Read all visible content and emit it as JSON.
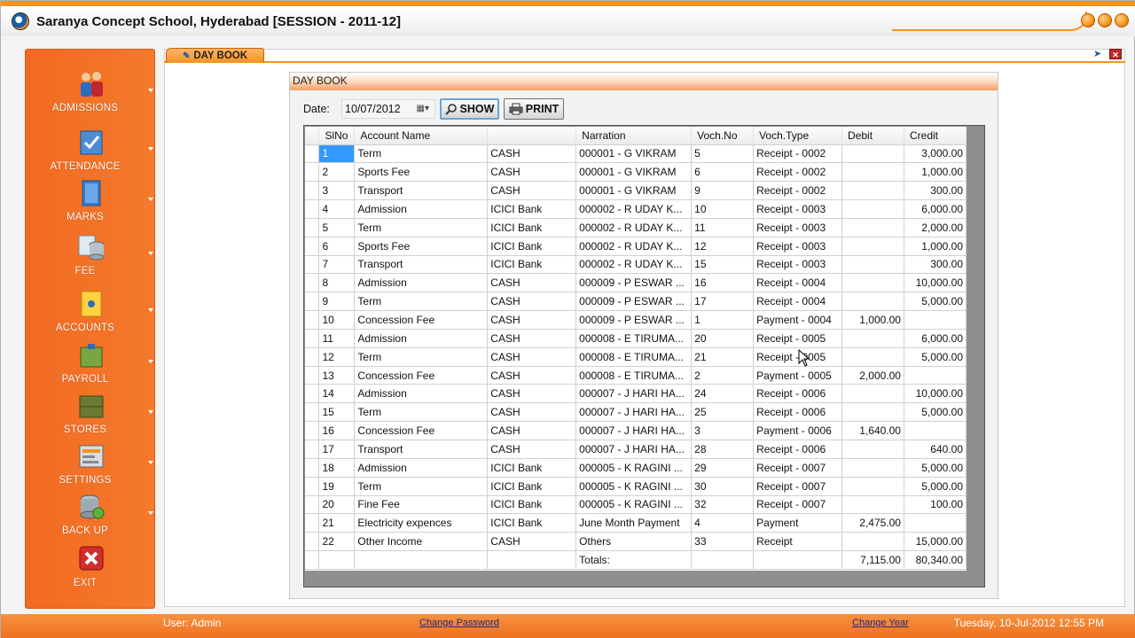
{
  "window": {
    "title": "Saranya Concept School, Hyderabad [SESSION - 2011-12]"
  },
  "sidebar": {
    "items": [
      {
        "label": "ADMISSIONS",
        "icon": "admissions-icon"
      },
      {
        "label": "ATTENDANCE",
        "icon": "attendance-icon"
      },
      {
        "label": "MARKS",
        "icon": "marks-icon"
      },
      {
        "label": "FEE",
        "icon": "fee-icon"
      },
      {
        "label": "ACCOUNTS",
        "icon": "accounts-icon"
      },
      {
        "label": "PAYROLL",
        "icon": "payroll-icon"
      },
      {
        "label": "STORES",
        "icon": "stores-icon"
      },
      {
        "label": "SETTINGS",
        "icon": "settings-icon"
      },
      {
        "label": "BACK UP",
        "icon": "backup-icon"
      },
      {
        "label": "EXIT",
        "icon": "exit-icon"
      }
    ]
  },
  "tab": {
    "label": "DAY BOOK"
  },
  "panel": {
    "header": "DAY BOOK",
    "date_label": "Date:",
    "date_value": "10/07/2012",
    "show_label": "SHOW",
    "print_label": "PRINT"
  },
  "grid": {
    "columns": [
      "SlNo",
      "Account Name",
      "",
      "Narration",
      "Voch.No",
      "Voch.Type",
      "Debit",
      "Credit"
    ],
    "rows": [
      [
        "1",
        "Term",
        "CASH",
        "000001 - G VIKRAM",
        "5",
        "Receipt - 0002",
        "",
        "3,000.00"
      ],
      [
        "2",
        "Sports Fee",
        "CASH",
        "000001 - G VIKRAM",
        "6",
        "Receipt - 0002",
        "",
        "1,000.00"
      ],
      [
        "3",
        "Transport",
        "CASH",
        "000001 - G VIKRAM",
        "9",
        "Receipt - 0002",
        "",
        "300.00"
      ],
      [
        "4",
        "Admission",
        "ICICI Bank",
        "000002 - R UDAY K...",
        "10",
        "Receipt - 0003",
        "",
        "6,000.00"
      ],
      [
        "5",
        "Term",
        "ICICI Bank",
        "000002 - R UDAY K...",
        "11",
        "Receipt - 0003",
        "",
        "2,000.00"
      ],
      [
        "6",
        "Sports Fee",
        "ICICI Bank",
        "000002 - R UDAY K...",
        "12",
        "Receipt - 0003",
        "",
        "1,000.00"
      ],
      [
        "7",
        "Transport",
        "ICICI Bank",
        "000002 - R UDAY K...",
        "15",
        "Receipt - 0003",
        "",
        "300.00"
      ],
      [
        "8",
        "Admission",
        "CASH",
        "000009 - P ESWAR ...",
        "16",
        "Receipt - 0004",
        "",
        "10,000.00"
      ],
      [
        "9",
        "Term",
        "CASH",
        "000009 - P ESWAR ...",
        "17",
        "Receipt - 0004",
        "",
        "5,000.00"
      ],
      [
        "10",
        "Concession Fee",
        "CASH",
        "000009 - P ESWAR ...",
        "1",
        "Payment - 0004",
        "1,000.00",
        ""
      ],
      [
        "11",
        "Admission",
        "CASH",
        "000008 - E TIRUMA...",
        "20",
        "Receipt - 0005",
        "",
        "6,000.00"
      ],
      [
        "12",
        "Term",
        "CASH",
        "000008 - E TIRUMA...",
        "21",
        "Receipt - 0005",
        "",
        "5,000.00"
      ],
      [
        "13",
        "Concession Fee",
        "CASH",
        "000008 - E TIRUMA...",
        "2",
        "Payment - 0005",
        "2,000.00",
        ""
      ],
      [
        "14",
        "Admission",
        "CASH",
        "000007 - J HARI HA...",
        "24",
        "Receipt - 0006",
        "",
        "10,000.00"
      ],
      [
        "15",
        "Term",
        "CASH",
        "000007 - J HARI HA...",
        "25",
        "Receipt - 0006",
        "",
        "5,000.00"
      ],
      [
        "16",
        "Concession Fee",
        "CASH",
        "000007 - J HARI HA...",
        "3",
        "Payment - 0006",
        "1,640.00",
        ""
      ],
      [
        "17",
        "Transport",
        "CASH",
        "000007 - J HARI HA...",
        "28",
        "Receipt - 0006",
        "",
        "640.00"
      ],
      [
        "18",
        "Admission",
        "ICICI Bank",
        "000005 - K RAGINI ...",
        "29",
        "Receipt - 0007",
        "",
        "5,000.00"
      ],
      [
        "19",
        "Term",
        "ICICI Bank",
        "000005 - K RAGINI ...",
        "30",
        "Receipt - 0007",
        "",
        "5,000.00"
      ],
      [
        "20",
        "Fine Fee",
        "ICICI Bank",
        "000005 - K RAGINI ...",
        "32",
        "Receipt - 0007",
        "",
        "100.00"
      ],
      [
        "21",
        "Electricity expences",
        "ICICI Bank",
        "June Month Payment",
        "4",
        "Payment",
        "2,475.00",
        ""
      ],
      [
        "22",
        "Other Income",
        "CASH",
        "Others",
        "33",
        "Receipt",
        "",
        "15,000.00"
      ],
      [
        "",
        "",
        "",
        "Totals:",
        "",
        "",
        "7,115.00",
        "80,340.00"
      ]
    ]
  },
  "status": {
    "user": "User: Admin",
    "change_password": "Change Password",
    "change_year": "Change Year",
    "datetime": "Tuesday, 10-Jul-2012 12:55 PM"
  },
  "colors": {
    "accent": "#f7931e",
    "sidebar": "#f26a21",
    "selection": "#3399ff"
  }
}
